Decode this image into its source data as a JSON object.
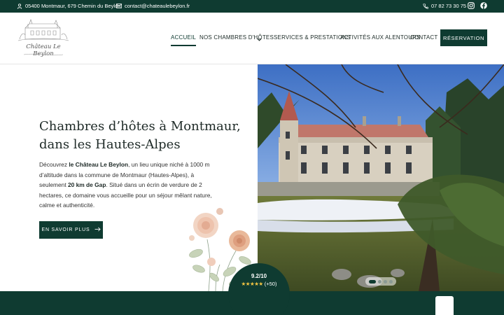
{
  "topbar": {
    "address": "05400 Montmaur, 679 Chemin du Beylon",
    "email": "contact@chateaulebeylon.fr",
    "phone": "07 82 73 30 75",
    "icons": [
      "user-location-icon",
      "mail-icon",
      "phone-icon",
      "instagram-icon",
      "facebook-icon"
    ]
  },
  "logo": {
    "text": "Château Le Beylon"
  },
  "nav": {
    "items": [
      {
        "label": "ACCUEIL",
        "active": true
      },
      {
        "label": "NOS CHAMBRES D'HÔTES",
        "active": false
      },
      {
        "label": "SERVICES & PRESTATIONS",
        "active": false
      },
      {
        "label": "ACTIVITÉS AUX ALENTOURS",
        "active": false
      },
      {
        "label": "CONTACT",
        "active": false
      }
    ],
    "reserve_label": "RÉSERVATION"
  },
  "hero": {
    "title": "Chambres d’hôtes à Montmaur, dans les Hautes-Alpes",
    "text_1": "Découvrez ",
    "text_bold_1": "le Château Le Beylon",
    "text_2": ", un lieu unique niché à 1000 m d’altitude dans la commune de Montmaur (Hautes-Alpes), à seulement ",
    "text_bold_2": "20 km de Gap",
    "text_3": ". Situé dans un écrin de verdure de 2 hectares, ce domaine vous accueille pour un séjour mêlant nature, calme et authenticité.",
    "button_label": "EN SAVOIR PLUS"
  },
  "carousel": {
    "slides": 4,
    "active_index": 0
  },
  "rating": {
    "score": "9.2/10",
    "stars": "★★★★★",
    "count": "(+50)"
  },
  "colors": {
    "primary": "#0f3b31",
    "star": "#f4c542"
  }
}
